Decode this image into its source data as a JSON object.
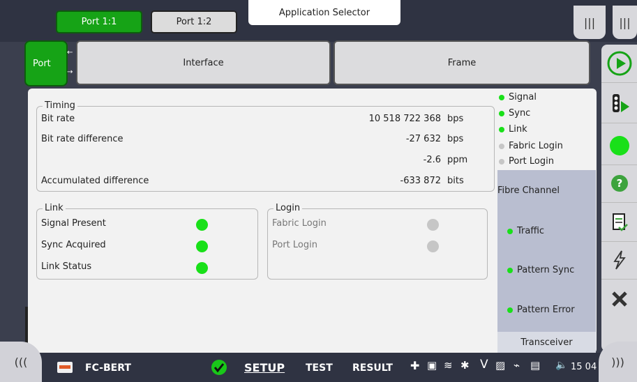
{
  "top": {
    "port_tabs": [
      "Port 1:1",
      "Port 1:2"
    ],
    "app_selector": "Application Selector",
    "menu_icon": "|||"
  },
  "subtabs": {
    "port": "Port",
    "interface": "Interface",
    "frame": "Frame"
  },
  "timing": {
    "title": "Timing",
    "rows": [
      {
        "label": "Bit rate",
        "value": "10 518 722 368",
        "unit": "bps"
      },
      {
        "label": "Bit rate difference",
        "value": "-27 632",
        "unit": "bps"
      },
      {
        "label": "",
        "value": "-2.6",
        "unit": "ppm"
      },
      {
        "label": "Accumulated difference",
        "value": "-633 872",
        "unit": "bits"
      }
    ]
  },
  "link": {
    "title": "Link",
    "rows": [
      {
        "label": "Signal Present",
        "on": true
      },
      {
        "label": "Sync Acquired",
        "on": true
      },
      {
        "label": "Link Status",
        "on": true
      }
    ]
  },
  "login": {
    "title": "Login",
    "rows": [
      {
        "label": "Fabric Login",
        "on": false
      },
      {
        "label": "Port Login",
        "on": false
      }
    ]
  },
  "status": {
    "items": [
      {
        "label": "Signal",
        "color": "#19e019"
      },
      {
        "label": "Sync",
        "color": "#19e019"
      },
      {
        "label": "Link",
        "color": "#19e019"
      },
      {
        "label": "Fabric Login",
        "color": "#c6c6c6"
      },
      {
        "label": "Port Login",
        "color": "#c6c6c6"
      }
    ],
    "fc_title": "Fibre Channel",
    "fc_items": [
      "Traffic",
      "Pattern Sync",
      "Pattern Error"
    ],
    "transceiver": "Transceiver"
  },
  "bottom": {
    "app_name": "FC-BERT",
    "setup": "SETUP",
    "test": "TEST",
    "result": "RESULT",
    "time": "15 04",
    "nav_left": "(((",
    "nav_right": ")))"
  },
  "colors": {
    "accent_green": "#16a316",
    "led_on": "#19e019",
    "led_off": "#c6c6c6"
  }
}
